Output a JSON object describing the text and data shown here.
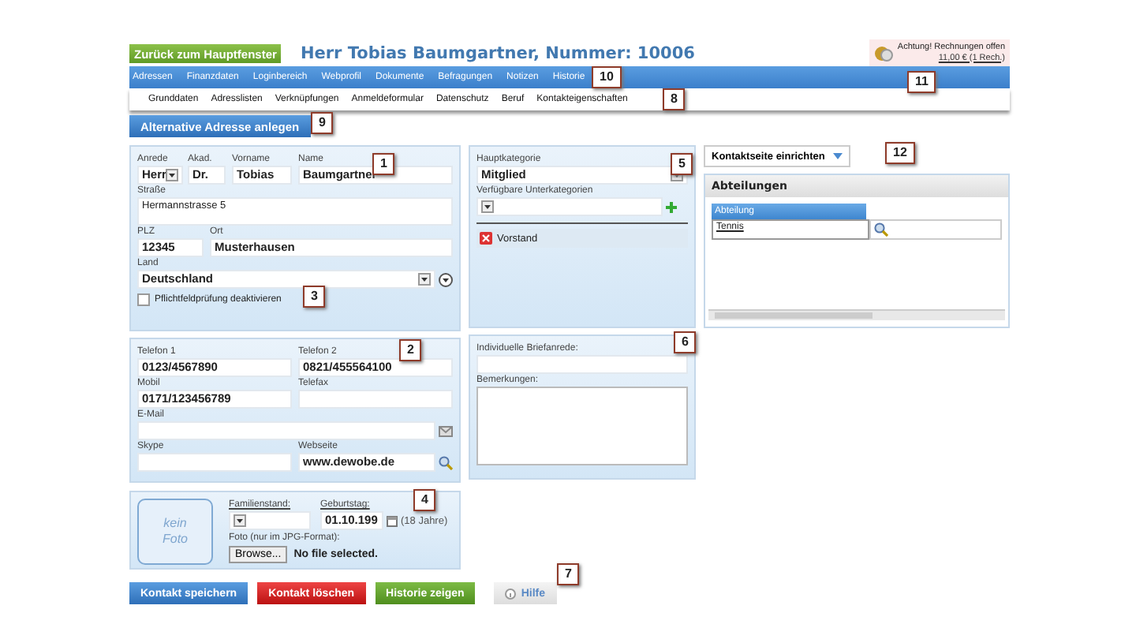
{
  "back_button": "Zurück zum Hauptfenster",
  "title": "Herr Tobias Baumgartner, Nummer: 10006",
  "notice": {
    "text": "Achtung! Rechnungen offen",
    "link": "11,00 € (1 Rech.)"
  },
  "menu": [
    "Adressen",
    "Finanzdaten",
    "Loginbereich",
    "Webprofil",
    "Dokumente",
    "Befragungen",
    "Notizen",
    "Historie"
  ],
  "subtabs": [
    "Grunddaten",
    "Adresslisten",
    "Verknüpfungen",
    "Anmeldeformular",
    "Datenschutz",
    "Beruf",
    "Kontakteigenschaften"
  ],
  "alt_address_button": "Alternative Adresse anlegen",
  "address": {
    "anrede": {
      "label": "Anrede",
      "value": "Herr"
    },
    "akad": {
      "label": "Akad.",
      "value": "Dr."
    },
    "vorname": {
      "label": "Vorname",
      "value": "Tobias"
    },
    "name": {
      "label": "Name",
      "value": "Baumgartner"
    },
    "strasse": {
      "label": "Straße",
      "value": "Hermannstrasse 5"
    },
    "plz": {
      "label": "PLZ",
      "value": "12345"
    },
    "ort": {
      "label": "Ort",
      "value": "Musterhausen"
    },
    "land": {
      "label": "Land",
      "value": "Deutschland"
    },
    "check": {
      "label": "Pflichtfeldprüfung deaktivieren",
      "checked": false
    }
  },
  "contact": [
    {
      "label": "Telefon 1",
      "value": "0123/4567890"
    },
    {
      "label": "Telefon 2",
      "value": "0821/455564100"
    },
    {
      "label": "Mobil",
      "value": "0171/123456789"
    },
    {
      "label": "Telefax"
    },
    {
      "label": "E-Mail",
      "kind": "email"
    },
    {
      "label": "Skype"
    },
    {
      "label": "Webseite",
      "value": "www.dewobe.de",
      "kind": "web"
    }
  ],
  "personal": {
    "photo": [
      "kein",
      "Foto"
    ],
    "familienstand": "Familienstand:",
    "geburtstag": {
      "label": "Geburtstag:",
      "value": "01.10.199",
      "age": "(18 Jahre)"
    },
    "foto_label": "Foto (nur im JPG-Format):",
    "browse": "Browse...",
    "file": "No file selected."
  },
  "category": {
    "label": "Hauptkategorie",
    "value": "Mitglied",
    "sub_label": "Verfügbare Unterkategorien",
    "tags": [
      "Vorstand"
    ]
  },
  "letter": {
    "salutation": "Individuelle Briefanrede:",
    "remarks": "Bemerkungen:"
  },
  "contact_page_button": "Kontaktseite einrichten",
  "departments": {
    "title": "Abteilungen",
    "column": "Abteilung",
    "rows": [
      "Tennis"
    ]
  },
  "actions": [
    {
      "label": "Kontakt speichern",
      "kind": "primary"
    },
    {
      "label": "Kontakt löschen",
      "kind": "danger"
    },
    {
      "label": "Historie zeigen",
      "kind": "success"
    },
    {
      "label": "Hilfe",
      "kind": "help"
    }
  ],
  "callouts": [
    "1",
    "2",
    "3",
    "4",
    "5",
    "6",
    "7",
    "8",
    "9",
    "10",
    "11",
    "12"
  ]
}
